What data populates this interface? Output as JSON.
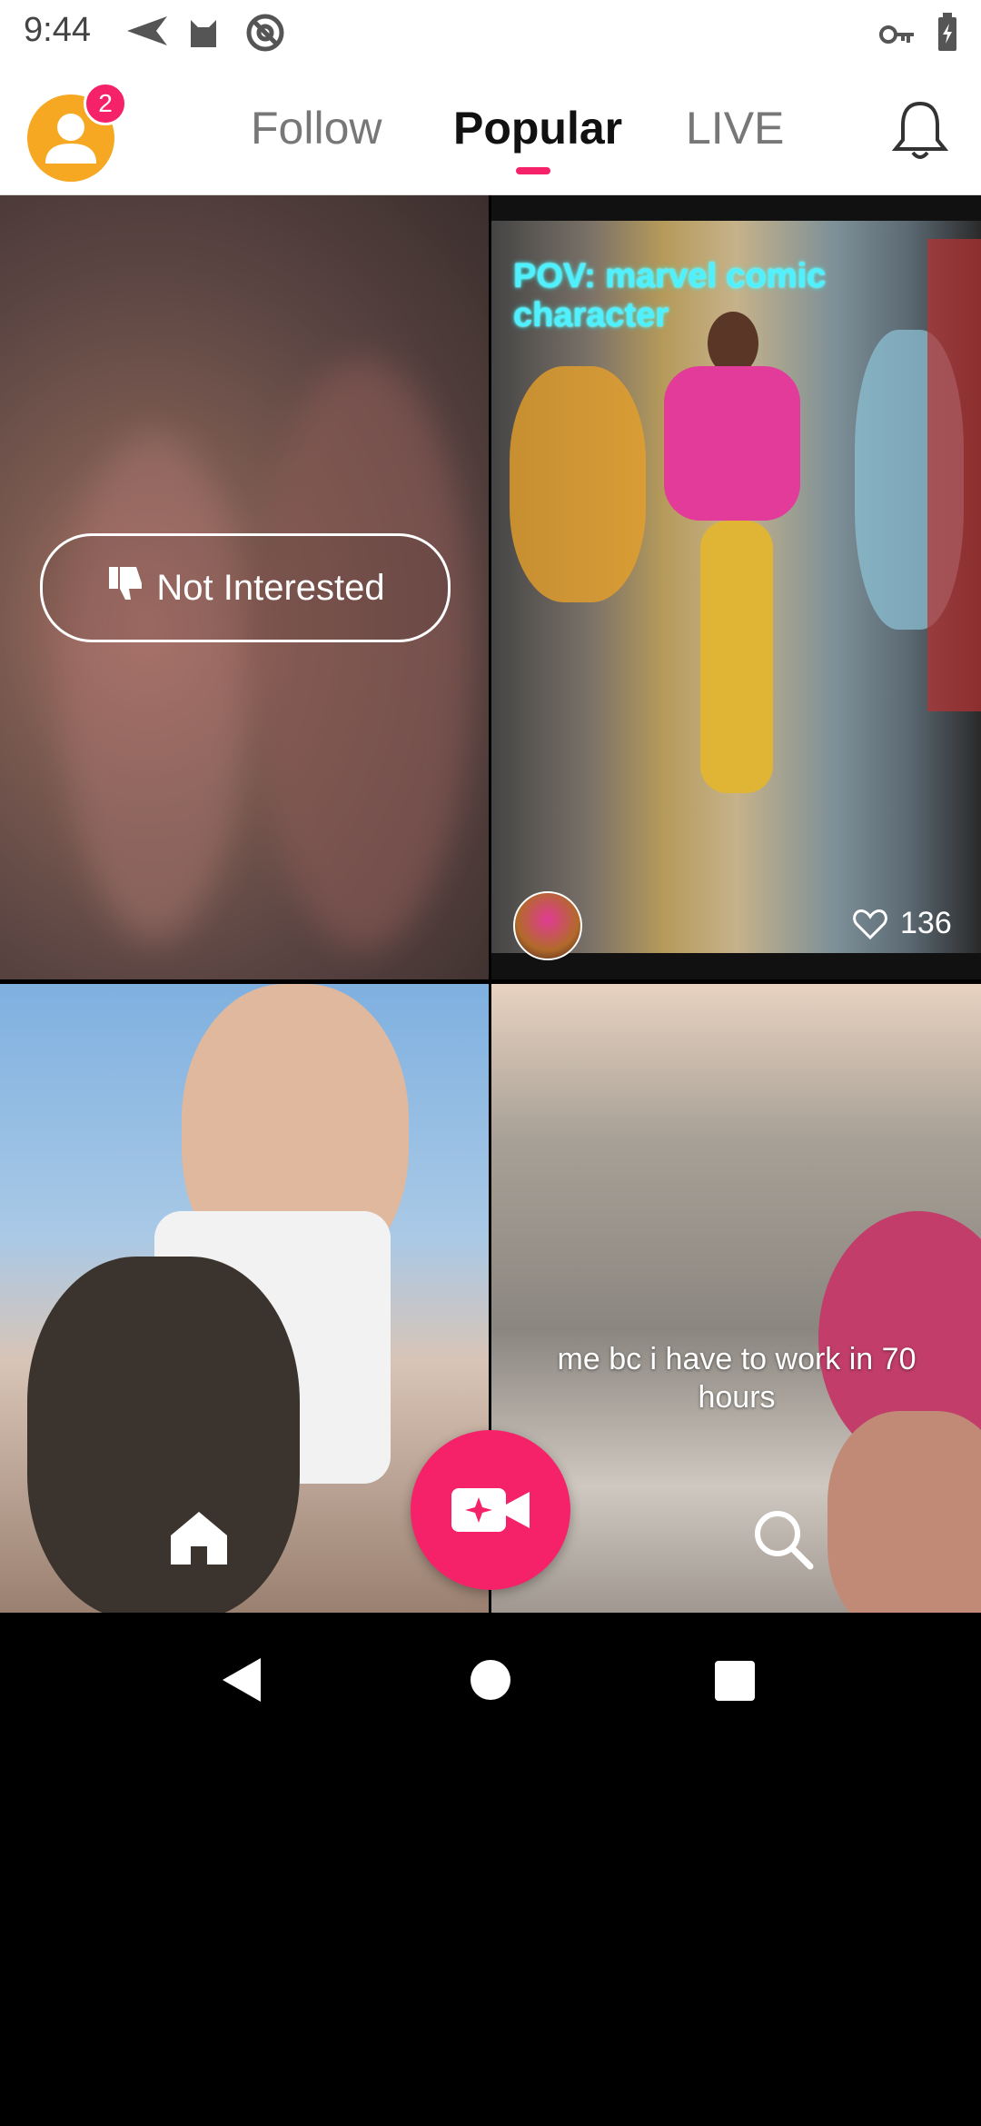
{
  "status_bar": {
    "time": "9:44",
    "icons": [
      "send-icon",
      "cat-icon",
      "at-icon",
      "key-icon",
      "battery-icon"
    ]
  },
  "header": {
    "notification_badge": "2",
    "tabs": [
      {
        "label": "Follow",
        "active": false
      },
      {
        "label": "Popular",
        "active": true
      },
      {
        "label": "LIVE",
        "active": false
      }
    ],
    "accent_color": "#f5226a",
    "avatar_color": "#f7a823"
  },
  "feed": {
    "tile1": {
      "action_label": "Not Interested"
    },
    "tile2": {
      "caption": "POV: marvel comic character",
      "likes": "136"
    },
    "tile4": {
      "caption": "me bc i have to work in 70 hours"
    }
  },
  "bottom_nav": {
    "items": [
      "home-icon",
      "record-video-icon",
      "search-icon"
    ]
  },
  "system_nav": {
    "items": [
      "back-icon",
      "home-icon",
      "recents-icon"
    ]
  }
}
